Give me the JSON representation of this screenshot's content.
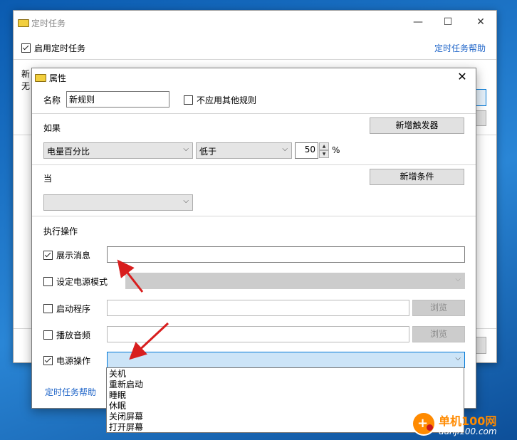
{
  "back_window": {
    "title": "定时任务",
    "min_glyph": "—",
    "max_glyph": "☐",
    "close_glyph": "✕",
    "enable_label": "启用定时任务",
    "help_link": "定时任务帮助",
    "line1": "新",
    "line2": "无"
  },
  "dialog": {
    "title": "属性",
    "close_glyph": "✕",
    "name_label": "名称",
    "name_value": "新规则",
    "no_other_rules_label": "不应用其他规则",
    "if_label": "如果",
    "add_trigger_button": "新增触发器",
    "trigger_type": "电量百分比",
    "comparison": "低于",
    "threshold_value": "50",
    "percent_sign": "%",
    "when_label": "当",
    "add_condition_button": "新增条件",
    "condition_value": "",
    "actions_label": "执行操作",
    "actions": {
      "show_message": {
        "label": "展示消息",
        "checked": true,
        "value": ""
      },
      "set_power_mode": {
        "label": "设定电源模式",
        "checked": false
      },
      "start_program": {
        "label": "启动程序",
        "checked": false,
        "browse": "浏览"
      },
      "play_audio": {
        "label": "播放音频",
        "checked": false,
        "browse": "浏览"
      },
      "power_action": {
        "label": "电源操作",
        "checked": true,
        "value": ""
      }
    },
    "help_link": "定时任务帮助",
    "power_options": [
      "关机",
      "重新启动",
      "睡眠",
      "休眠",
      "关闭屏幕",
      "打开屏幕"
    ]
  },
  "watermark": {
    "name": "单机100网",
    "url": "danji100.com"
  },
  "colors": {
    "link": "#1e64c8",
    "arrow": "#d81e1e",
    "accent": "#0078d7"
  }
}
